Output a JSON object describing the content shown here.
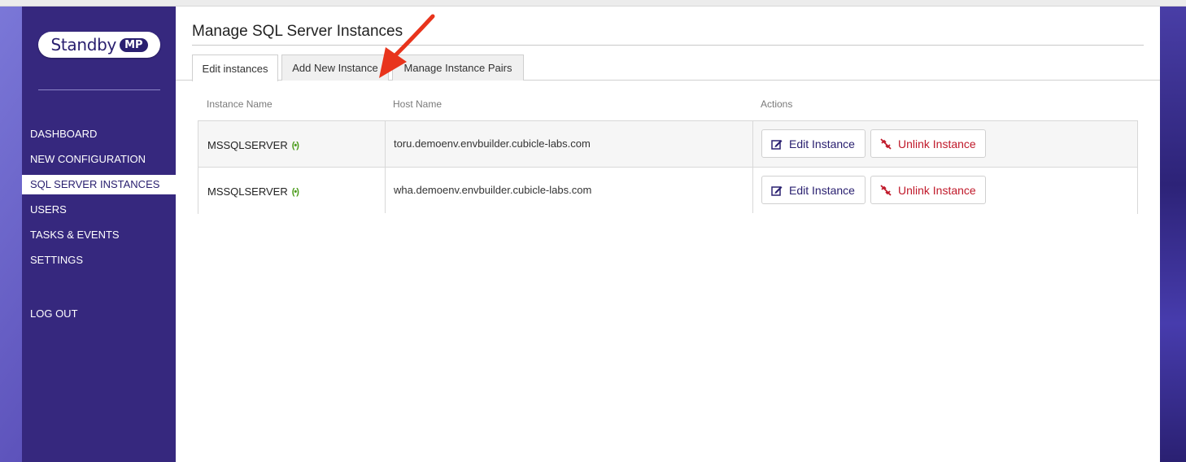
{
  "app": {
    "logo_text": "Standby",
    "logo_badge": "MP"
  },
  "colors": {
    "sidebar": "#36287e",
    "accent": "#2a2070",
    "danger": "#c0192a",
    "status_online": "#4a9b1a",
    "annotation_arrow": "#e8341c"
  },
  "sidebar": {
    "items": [
      {
        "label": "DASHBOARD",
        "active": false
      },
      {
        "label": "NEW CONFIGURATION",
        "active": false
      },
      {
        "label": "SQL SERVER INSTANCES",
        "active": true
      },
      {
        "label": "USERS",
        "active": false
      },
      {
        "label": "TASKS & EVENTS",
        "active": false
      },
      {
        "label": "SETTINGS",
        "active": false
      }
    ],
    "logout_label": "LOG OUT"
  },
  "main": {
    "title": "Manage SQL Server Instances",
    "tabs": [
      {
        "label": "Edit instances",
        "active": true
      },
      {
        "label": "Add New Instance",
        "active": false
      },
      {
        "label": "Manage Instance Pairs",
        "active": false
      }
    ],
    "table": {
      "headers": [
        "Instance Name",
        "Host Name",
        "Actions"
      ],
      "rows": [
        {
          "instance": "MSSQLSERVER",
          "status_icon": "signal-online-icon",
          "host": "toru.demoenv.envbuilder.cubicle-labs.com",
          "edit_label": "Edit Instance",
          "unlink_label": "Unlink Instance"
        },
        {
          "instance": "MSSQLSERVER",
          "status_icon": "signal-online-icon",
          "host": "wha.demoenv.envbuilder.cubicle-labs.com",
          "edit_label": "Edit Instance",
          "unlink_label": "Unlink Instance"
        }
      ]
    }
  }
}
